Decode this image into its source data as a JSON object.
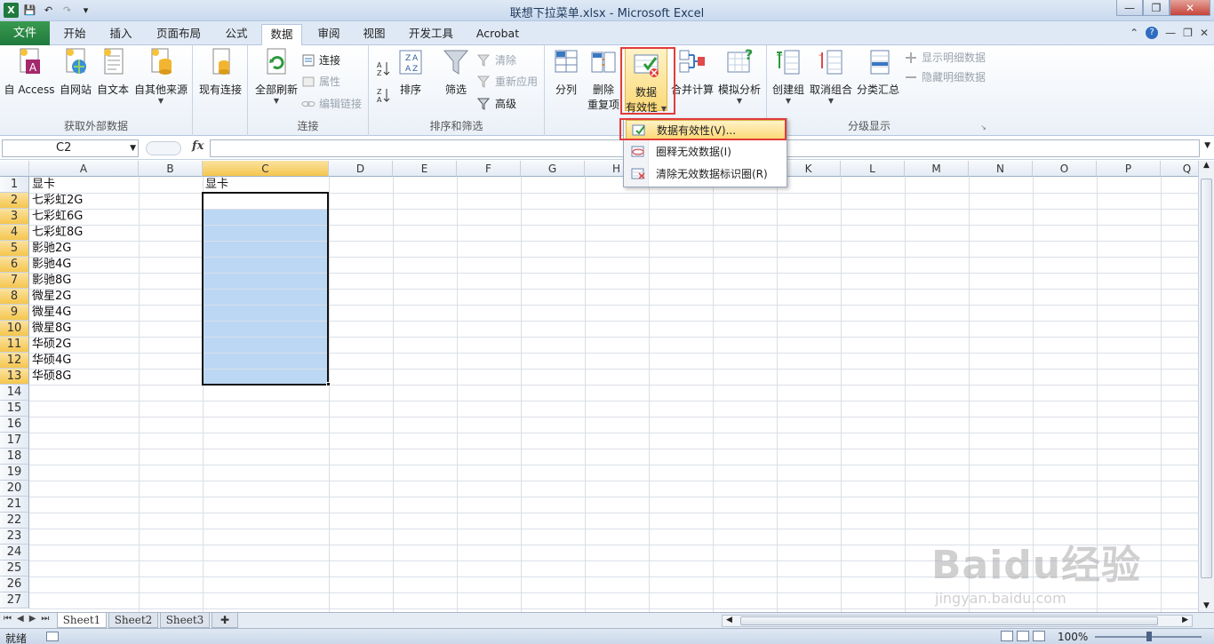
{
  "window": {
    "title": "联想下拉菜单.xlsx - Microsoft Excel"
  },
  "tabs": [
    {
      "label": "文件"
    },
    {
      "label": "开始"
    },
    {
      "label": "插入"
    },
    {
      "label": "页面布局"
    },
    {
      "label": "公式"
    },
    {
      "label": "数据"
    },
    {
      "label": "审阅"
    },
    {
      "label": "视图"
    },
    {
      "label": "开发工具"
    },
    {
      "label": "Acrobat"
    }
  ],
  "ribbon": {
    "get_external": {
      "label": "获取外部数据",
      "from_access": "自 Access",
      "from_web": "自网站",
      "from_text": "自文本",
      "from_other": "自其他来源",
      "existing": "现有连接"
    },
    "connections": {
      "label": "连接",
      "refresh_all": "全部刷新",
      "connections": "连接",
      "properties": "属性",
      "edit_links": "编辑链接"
    },
    "sort_filter": {
      "label": "排序和筛选",
      "sort": "排序",
      "filter": "筛选",
      "clear": "清除",
      "reapply": "重新应用",
      "advanced": "高级"
    },
    "data_tools": {
      "text_to_columns": "分列",
      "remove_dup_1": "删除",
      "remove_dup_2": "重复项",
      "validation_1": "数据",
      "validation_2": "有效性",
      "consolidate": "合并计算",
      "what_if": "模拟分析"
    },
    "outline": {
      "label": "分级显示",
      "group": "创建组",
      "ungroup": "取消组合",
      "subtotal": "分类汇总",
      "show_detail": "显示明细数据",
      "hide_detail": "隐藏明细数据"
    }
  },
  "formula_bar": {
    "name_box": "C2",
    "fx": "fx",
    "formula": ""
  },
  "columns": [
    "A",
    "B",
    "C",
    "D",
    "E",
    "F",
    "G",
    "H",
    "I",
    "J",
    "K",
    "L",
    "M",
    "N",
    "O",
    "P",
    "Q"
  ],
  "rows": [
    "1",
    "2",
    "3",
    "4",
    "5",
    "6",
    "7",
    "8",
    "9",
    "10",
    "11",
    "12",
    "13",
    "14",
    "15",
    "16",
    "17",
    "18",
    "19",
    "20",
    "21",
    "22",
    "23",
    "24",
    "25",
    "26",
    "27"
  ],
  "cells": {
    "a": [
      "显卡",
      "七彩虹2G",
      "七彩虹6G",
      "七彩虹8G",
      "影驰2G",
      "影驰4G",
      "影驰8G",
      "微星2G",
      "微星4G",
      "微星8G",
      "华硕2G",
      "华硕4G",
      "华硕8G"
    ],
    "c1": "显卡"
  },
  "menu": {
    "items": [
      {
        "label": "数据有效性(V)..."
      },
      {
        "label": "圈释无效数据(I)"
      },
      {
        "label": "清除无效数据标识圈(R)"
      }
    ]
  },
  "sheets": [
    {
      "label": "Sheet1"
    },
    {
      "label": "Sheet2"
    },
    {
      "label": "Sheet3"
    }
  ],
  "status": {
    "ready": "就绪",
    "zoom": "100%"
  },
  "watermark": {
    "brand": "Baidu经验",
    "url": "jingyan.baidu.com"
  }
}
